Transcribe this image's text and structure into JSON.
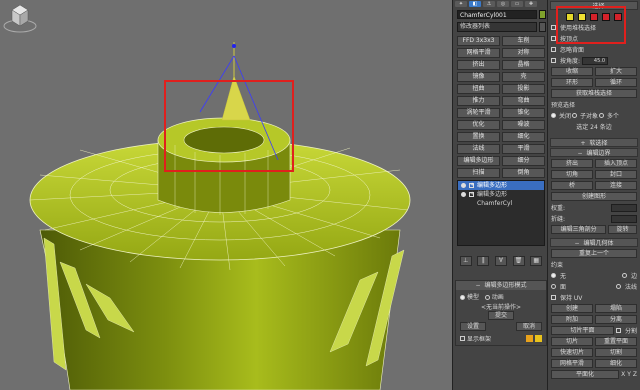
{
  "viewport": {
    "name": "perspective-viewport",
    "mesh_color": "#a6b81e",
    "wire_color": "#f2f5c8"
  },
  "panel": {
    "tabs": [
      "create",
      "modify",
      "hierarchy",
      "motion",
      "display",
      "utilities"
    ],
    "object_name": "ChamferCyl001",
    "object_color": "#7fa22c",
    "modifier_list": "修改器列表",
    "modifier_buttons": [
      [
        "FFD 3x3x3",
        "车削"
      ],
      [
        "网格平滑",
        "对称"
      ],
      [
        "挤出",
        "晶格"
      ],
      [
        "镜像",
        "壳"
      ],
      [
        "扭曲",
        "投影"
      ],
      [
        "推力",
        "弯曲"
      ],
      [
        "涡轮平滑",
        "锥化"
      ],
      [
        "优化",
        "噪波"
      ],
      [
        "置换",
        "细化"
      ],
      [
        "法线",
        "平滑"
      ],
      [
        "编辑多边形",
        "细分"
      ],
      [
        "扫描",
        "倒角"
      ]
    ],
    "stack_items": [
      {
        "label": "编辑多边形",
        "selected": true
      },
      {
        "label": "编辑多边形",
        "selected": false
      },
      {
        "label": "ChamferCyl",
        "selected": false
      }
    ],
    "edit_poly_mode": {
      "title": "编辑多边形模式",
      "model": "模型",
      "animate": "动画",
      "no_op": "<无当前操作>",
      "commit": "提交",
      "settings": "设置",
      "cancel": "取消",
      "show_cage": "显示框架"
    }
  },
  "right": {
    "selection_title": "选择",
    "use_stack": "使用堆栈选择",
    "by_vertex": "按顶点",
    "ignore_backfacing": "忽略背面",
    "by_angle": "按角度:",
    "by_angle_value": "45.0",
    "shrink": "收缩",
    "grow": "扩大",
    "ring": "环形",
    "loop": "循环",
    "get_stack_selection": "获取堆栈选择",
    "preview_selection": "预览选择",
    "off": "关闭",
    "subobject": "子对象",
    "multi": "多个",
    "selected_count": "选定 24 条边",
    "soft_selection": "软选择",
    "edit_edges": "编辑边界",
    "insert_vertex": "插入顶点",
    "extrude": "挤出",
    "cap": "封口",
    "chamfer": "切角",
    "bridge": "桥",
    "connect": "连接",
    "create_shape": "创建图形",
    "weight": "权重:",
    "crease": "折缝:",
    "edit_tri": "编辑三角剖分",
    "rotate": "旋转",
    "edit_geometry": "编辑几何体",
    "repeat_last": "重复上一个",
    "constraints": "约束",
    "none": "无",
    "edge": "边",
    "face": "面",
    "normal": "法线",
    "preserve_uv": "保持 UV",
    "create": "创建",
    "collapse": "塌陷",
    "attach": "附加",
    "detach": "分离",
    "slice_plane": "切片平面",
    "split": "分割",
    "slice": "切片",
    "reset_plane": "重置平面",
    "quickslice": "快速切片",
    "cut": "切割",
    "mesh_smooth": "网格平滑",
    "tessellate": "细化",
    "make_planar": "平面化",
    "x": "X",
    "y": "Y",
    "z": "Z"
  }
}
